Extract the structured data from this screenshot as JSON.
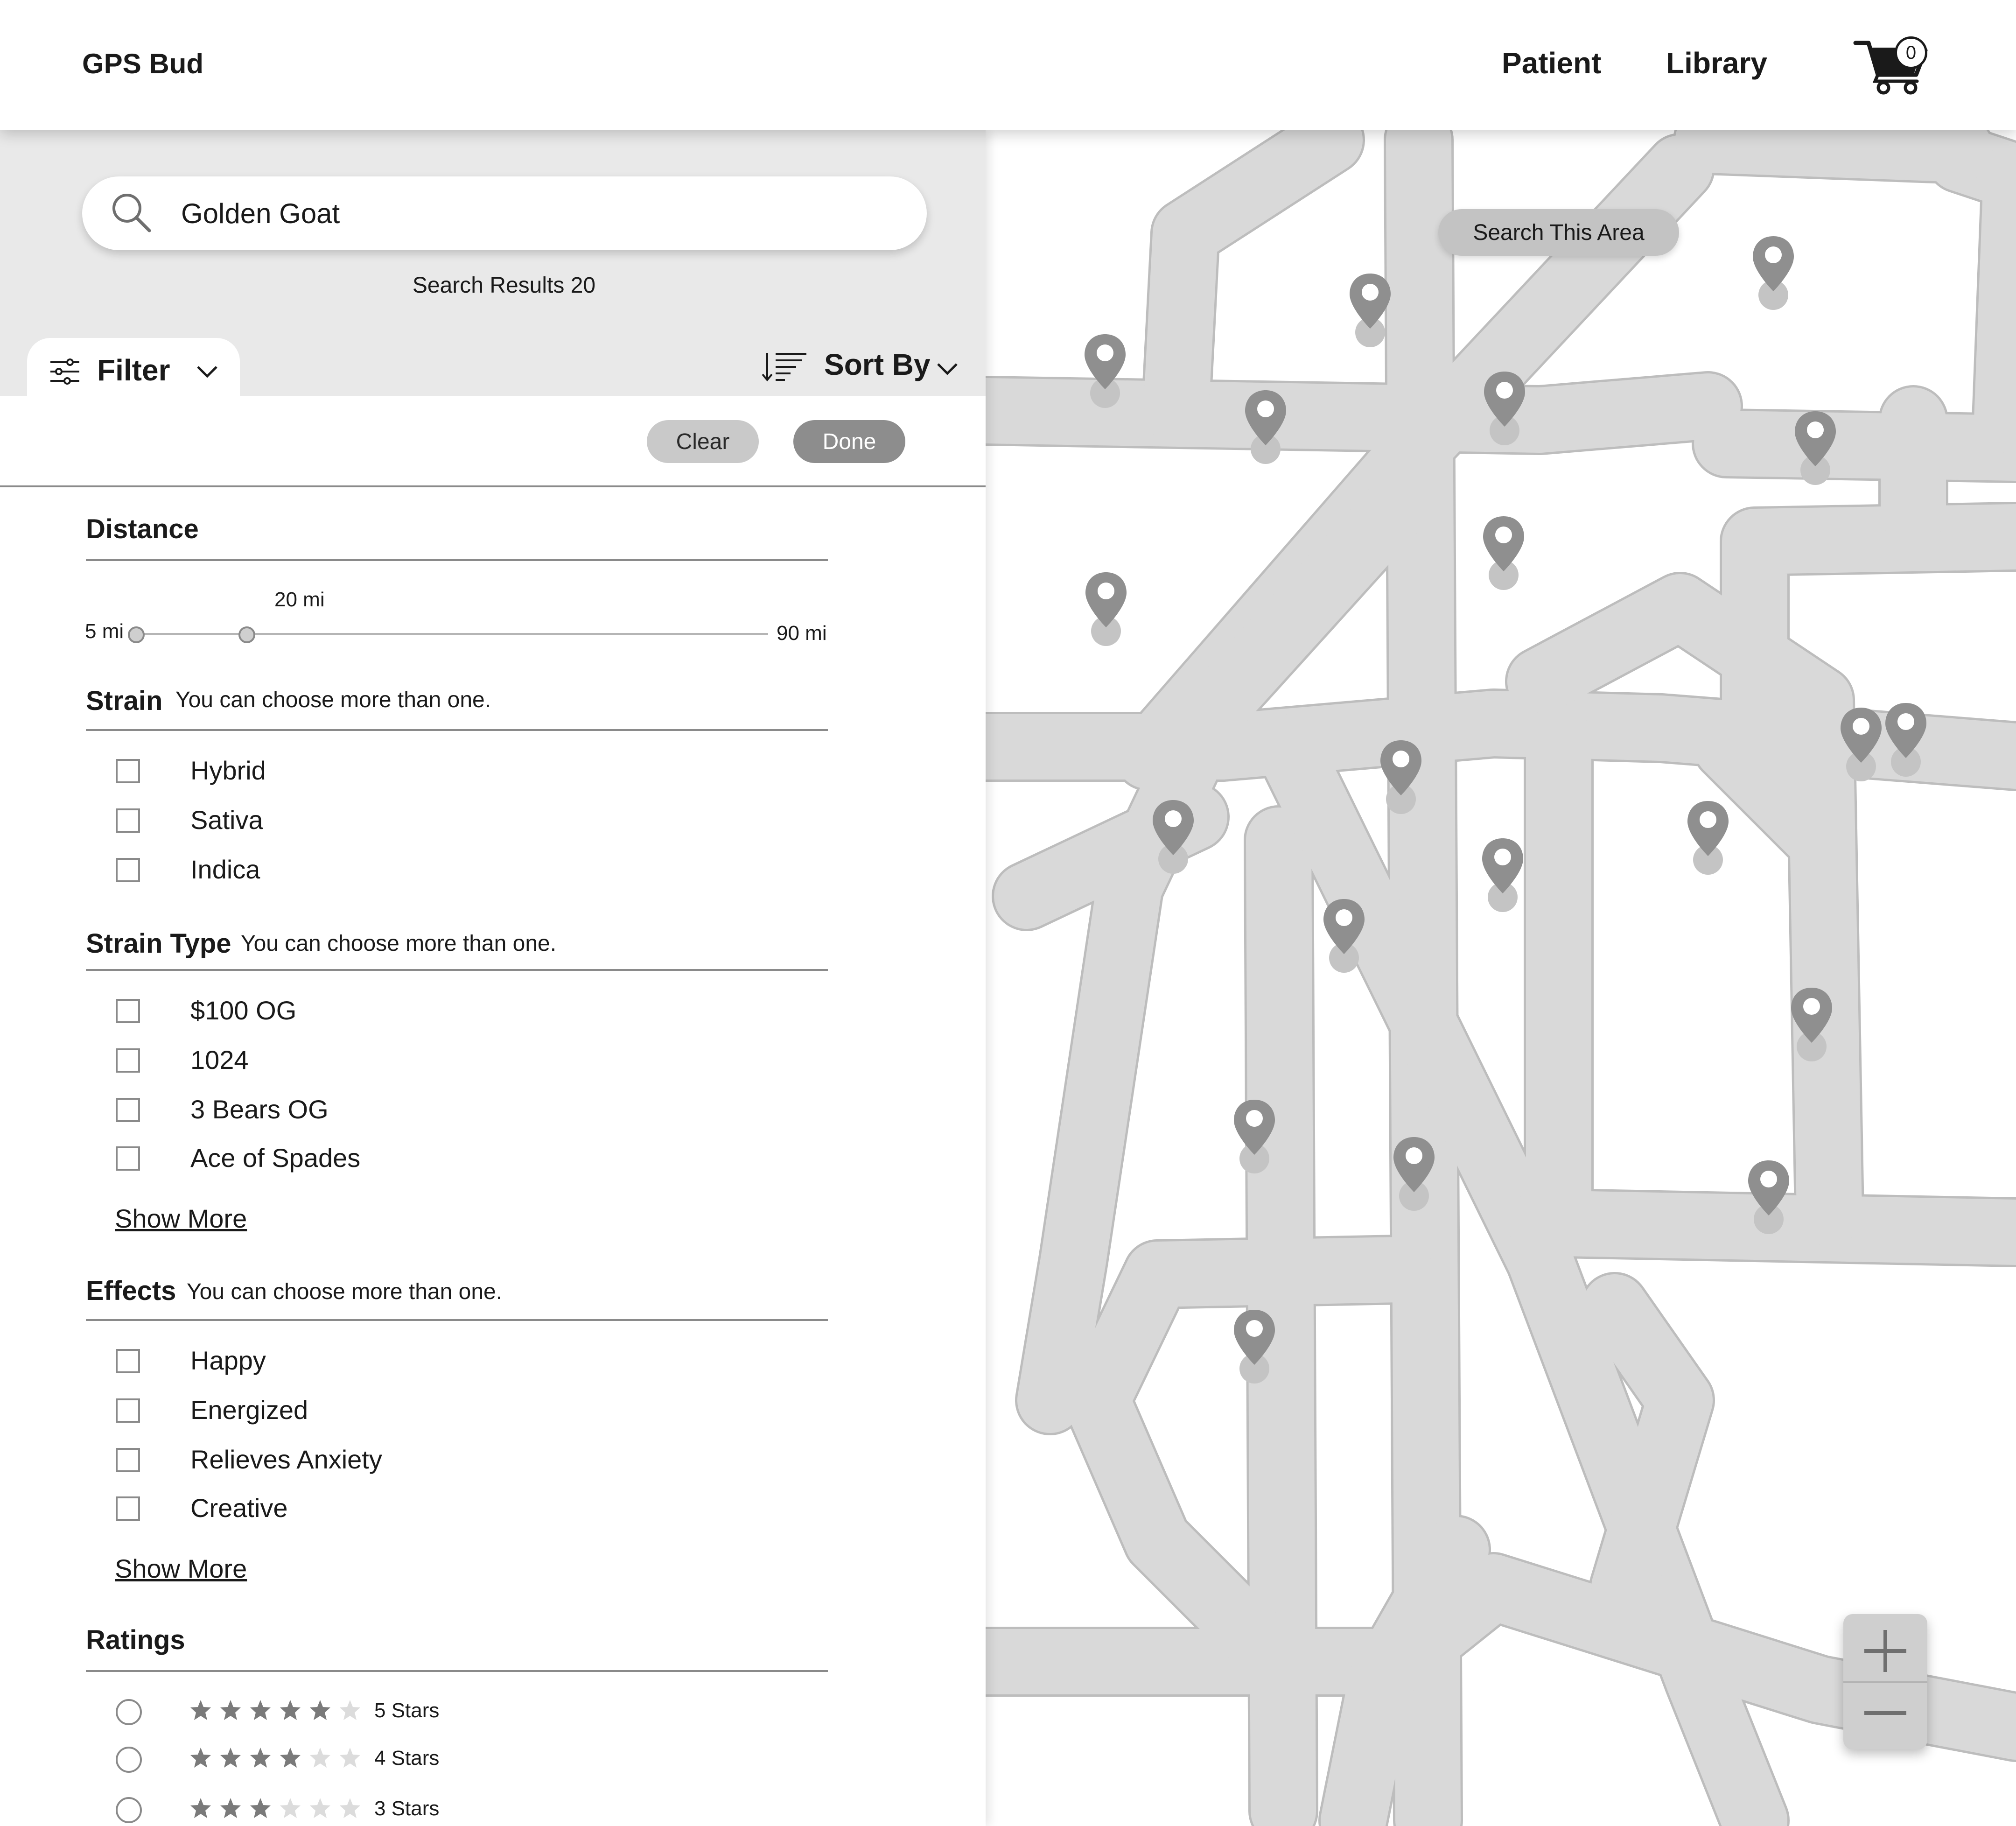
{
  "app": {
    "brand": "GPS Bud"
  },
  "nav": {
    "patient": "Patient",
    "library": "Library",
    "cart_count": "0"
  },
  "search": {
    "value": "Golden Goat",
    "results_text": "Search Results 20"
  },
  "toolbar": {
    "filter_label": "Filter",
    "sort_label": "Sort By",
    "clear_label": "Clear",
    "done_label": "Done"
  },
  "distance": {
    "title": "Distance",
    "min_label": "5 mi",
    "max_label": "90 mi",
    "value_label": "20 mi",
    "min": 5,
    "max": 90,
    "value": 20
  },
  "strain": {
    "title": "Strain",
    "subtitle": "You can choose more than one.",
    "options": [
      "Hybrid",
      "Sativa",
      "Indica"
    ]
  },
  "strain_type": {
    "title": "Strain Type",
    "subtitle": "You can choose more than one.",
    "options": [
      "$100 OG",
      "1024",
      "3 Bears OG",
      "Ace of Spades"
    ],
    "show_more": "Show More"
  },
  "effects": {
    "title": "Effects",
    "subtitle": "You can choose more than one.",
    "options": [
      "Happy",
      "Energized",
      "Relieves Anxiety",
      "Creative"
    ],
    "show_more": "Show More"
  },
  "ratings": {
    "title": "Ratings",
    "options": [
      {
        "label": "5 Stars",
        "stars": 5
      },
      {
        "label": "4 Stars",
        "stars": 4
      },
      {
        "label": "3 Stars",
        "stars": 3
      }
    ]
  },
  "map": {
    "search_area_label": "Search This Area",
    "pin_count": 20,
    "colors": {
      "road": "#d9d9d9",
      "road_edge": "#bdbdbd",
      "pin": "#8f8f8f",
      "pin_shadow": "#c4c4c4"
    }
  },
  "zoom": {
    "in_icon": "plus-icon",
    "out_icon": "minus-icon"
  }
}
